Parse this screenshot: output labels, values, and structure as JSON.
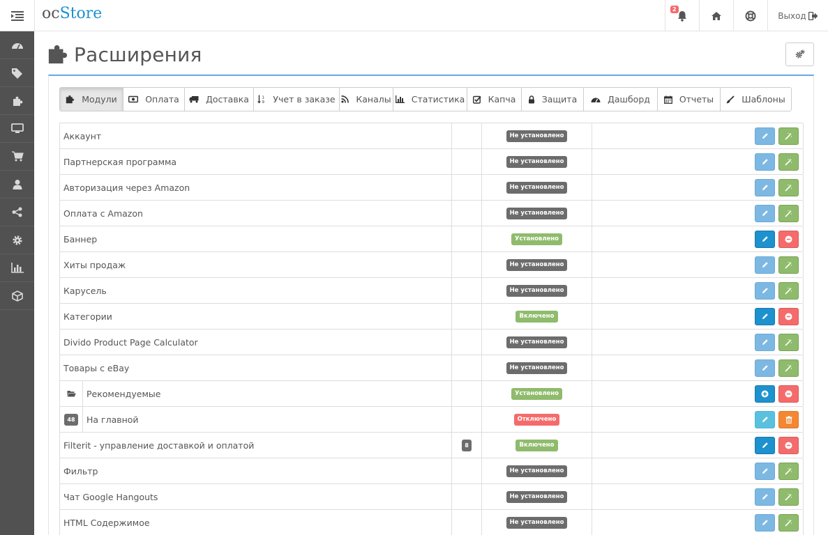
{
  "header": {
    "logo_oc": "oc",
    "logo_store": "Store",
    "notification_count": "2",
    "logout_label": "Выход"
  },
  "page": {
    "title": "Расширения"
  },
  "tabs": [
    {
      "label": "Модули",
      "icon": "puzzle-icon",
      "active": true
    },
    {
      "label": "Оплата",
      "icon": "money-icon"
    },
    {
      "label": "Доставка",
      "icon": "truck-icon"
    },
    {
      "label": "Учет в заказе",
      "icon": "sort-numeric-icon"
    },
    {
      "label": "Каналы",
      "icon": "rss-icon"
    },
    {
      "label": "Статистика",
      "icon": "bar-chart-icon"
    },
    {
      "label": "Капча",
      "icon": "check-square-icon"
    },
    {
      "label": "Защита",
      "icon": "lock-icon"
    },
    {
      "label": "Дашборд",
      "icon": "dashboard-icon"
    },
    {
      "label": "Отчеты",
      "icon": "calendar-icon"
    },
    {
      "label": "Шаблоны",
      "icon": "paint-brush-icon"
    }
  ],
  "modules": [
    {
      "name": "Аккаунт",
      "status": "Не установлено"
    },
    {
      "name": "Партнерская программа",
      "status": "Не установлено"
    },
    {
      "name": "Авторизация через Amazon",
      "status": "Не установлено"
    },
    {
      "name": "Оплата с Amazon",
      "status": "Не установлено"
    },
    {
      "name": "Баннер",
      "status": "Установлено"
    },
    {
      "name": "Хиты продаж",
      "status": "Не установлено"
    },
    {
      "name": "Карусель",
      "status": "Не установлено"
    },
    {
      "name": "Категории",
      "status": "Включено"
    },
    {
      "name": "Divido Product Page Calculator",
      "status": "Не установлено"
    },
    {
      "name": "Товары с eBay",
      "status": "Не установлено"
    },
    {
      "name": "Рекомендуемые",
      "status": "Установлено"
    },
    {
      "name": "На главной",
      "status": "Отключено",
      "count": "48"
    },
    {
      "name": "Filterit - управление доставкой и оплатой",
      "status": "Включено",
      "count": "8"
    },
    {
      "name": "Фильтр",
      "status": "Не установлено"
    },
    {
      "name": "Чат Google Hangouts",
      "status": "Не установлено"
    },
    {
      "name": "HTML Содержимое",
      "status": "Не установлено"
    }
  ],
  "colors": {
    "brand": "#1e91cf",
    "sidebar": "#515151",
    "success": "#8fbb6c",
    "danger": "#f56b6b",
    "warning": "#f38733",
    "info": "#5bc0de",
    "default_label": "#6c6c6c"
  }
}
